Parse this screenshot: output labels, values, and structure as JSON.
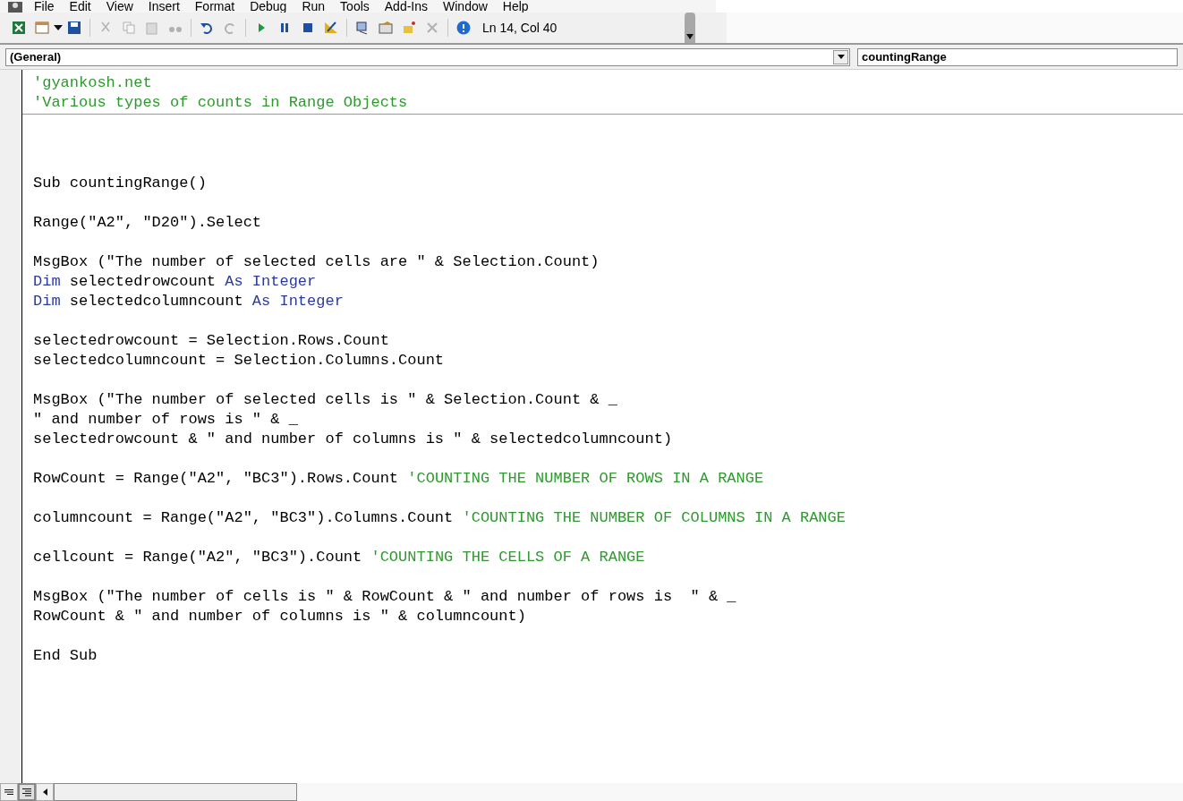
{
  "menu": [
    "File",
    "Edit",
    "View",
    "Insert",
    "Format",
    "Debug",
    "Run",
    "Tools",
    "Add-Ins",
    "Window",
    "Help"
  ],
  "toolbar": {
    "position": "Ln 14, Col 40"
  },
  "object_box": {
    "value": "(General)"
  },
  "procedure_box": {
    "value": "countingRange"
  },
  "declarations": [
    [
      {
        "kind": "comment",
        "text": "'gyankosh.net"
      }
    ],
    [
      {
        "kind": "comment",
        "text": "'Various types of counts in Range Objects"
      }
    ]
  ],
  "code_paragraphs": [
    [
      [
        {
          "kind": "plain",
          "text": "Sub countingRange()"
        }
      ]
    ],
    [
      [
        {
          "kind": "plain",
          "text": "Range(\"A2\", \"D20\").Select"
        }
      ]
    ],
    [
      [
        {
          "kind": "plain",
          "text": "MsgBox (\"The number of selected cells are \" & Selection.Count)"
        }
      ],
      [
        {
          "kind": "keyword",
          "text": "Dim"
        },
        {
          "kind": "plain",
          "text": " selectedrowcount "
        },
        {
          "kind": "keyword",
          "text": "As Integer"
        }
      ],
      [
        {
          "kind": "keyword",
          "text": "Dim"
        },
        {
          "kind": "plain",
          "text": " selectedcolumncount "
        },
        {
          "kind": "keyword",
          "text": "As Integer"
        }
      ]
    ],
    [
      [
        {
          "kind": "plain",
          "text": "selectedrowcount = Selection.Rows.Count"
        }
      ],
      [
        {
          "kind": "plain",
          "text": "selectedcolumncount = Selection.Columns.Count"
        }
      ]
    ],
    [
      [
        {
          "kind": "plain",
          "text": "MsgBox (\"The number of selected cells is \" & Selection.Count & _"
        }
      ],
      [
        {
          "kind": "plain",
          "text": "\" and number of rows is \" & _"
        }
      ],
      [
        {
          "kind": "plain",
          "text": "selectedrowcount & \" and number of columns is \" & selectedcolumncount)"
        }
      ]
    ],
    [
      [
        {
          "kind": "plain",
          "text": "RowCount = Range(\"A2\", \"BC3\").Rows.Count "
        },
        {
          "kind": "comment",
          "text": "'COUNTING THE NUMBER OF ROWS IN A RANGE"
        }
      ]
    ],
    [
      [
        {
          "kind": "plain",
          "text": "columncount = Range(\"A2\", \"BC3\").Columns.Count "
        },
        {
          "kind": "comment",
          "text": "'COUNTING THE NUMBER OF COLUMNS IN A RANGE"
        }
      ]
    ],
    [
      [
        {
          "kind": "plain",
          "text": "cellcount = Range(\"A2\", \"BC3\").Count "
        },
        {
          "kind": "comment",
          "text": "'COUNTING THE CELLS OF A RANGE"
        }
      ]
    ],
    [
      [
        {
          "kind": "plain",
          "text": "MsgBox (\"The number of cells is \" & RowCount & \" and number of rows is  \" & _"
        }
      ],
      [
        {
          "kind": "plain",
          "text": "RowCount & \" and number of columns is \" & columncount)"
        }
      ]
    ],
    [
      [
        {
          "kind": "plain",
          "text": "End Sub"
        }
      ]
    ]
  ]
}
